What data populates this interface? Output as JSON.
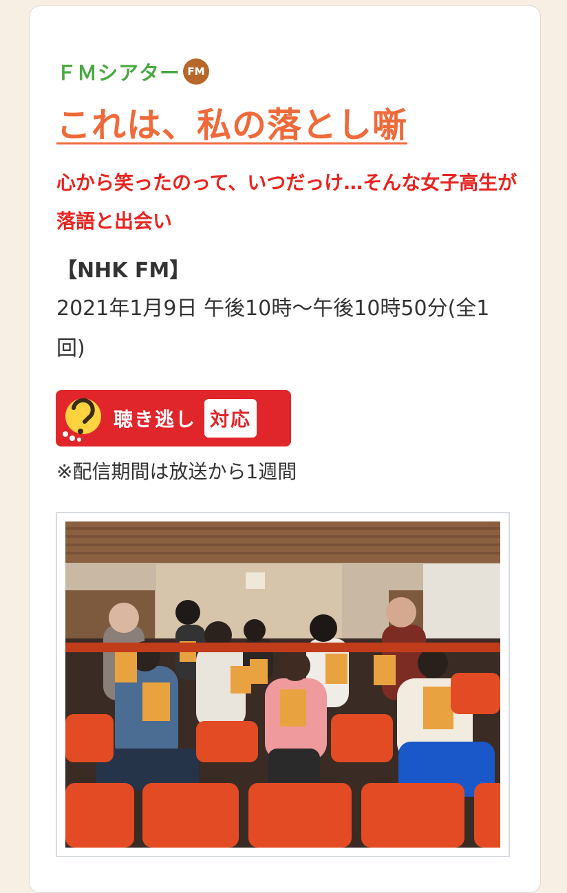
{
  "program": {
    "genre": "ＦＭシアター",
    "genre_badge": "FM",
    "title": "これは、私の落とし噺",
    "subtitle": "心から笑ったのって、いつだっけ…そんな女子高生が落語と出会い",
    "channel": "【NHK FM】",
    "airtime": "2021年1月9日 午後10時～午後10時50分(全1回)",
    "catchup": {
      "label": "聴き逃し",
      "tag": "対応",
      "icon": "catchup-radio-icon"
    },
    "note": "※配信期間は放送から1週間"
  },
  "colors": {
    "genre": "#4aa843",
    "title": "#ef6a3a",
    "subtitle": "#e8231f",
    "badge": "#e0262b"
  }
}
